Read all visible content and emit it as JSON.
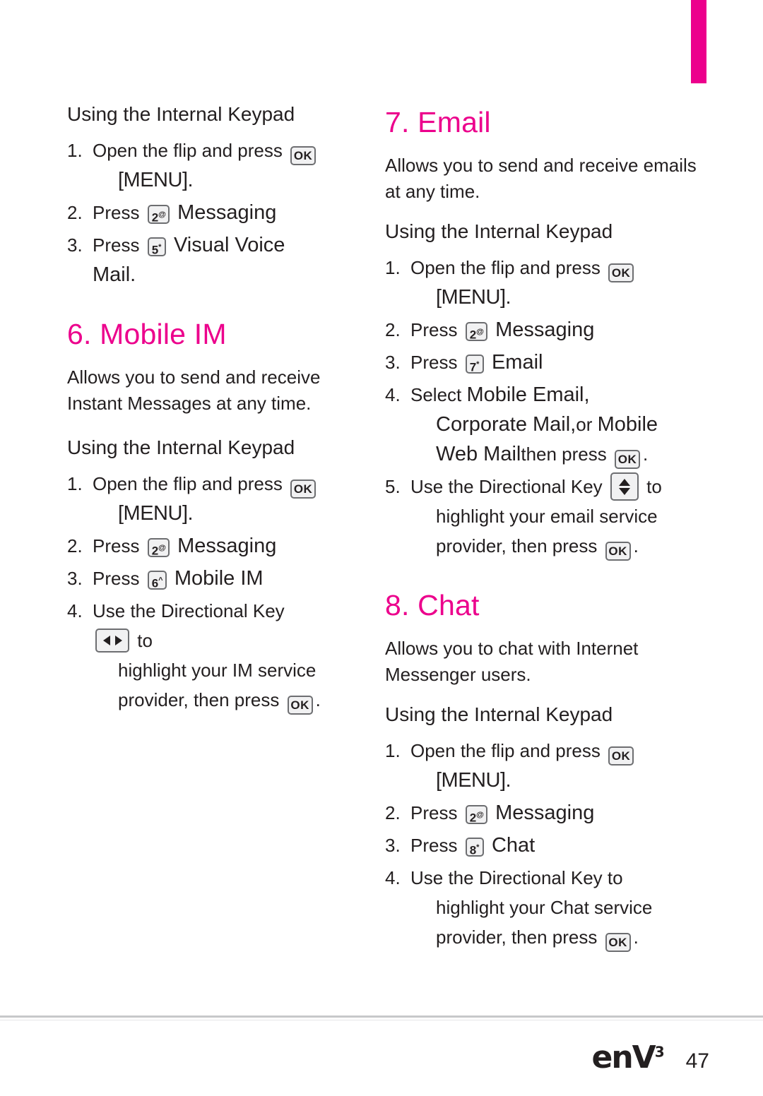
{
  "page": {
    "number": "47",
    "logo_text": "enV",
    "logo_sup": "3",
    "logo_dot": "·"
  },
  "left_column": {
    "keypad_heading_1": "Using the Internal Keypad",
    "vvm_steps": [
      {
        "num": "1.",
        "text_before": "Open the flip and press",
        "key": "OK",
        "text_after": "",
        "second_line": "[MENU]."
      },
      {
        "num": "2.",
        "text_before": "Press",
        "key": "2",
        "key_sup": "@",
        "text_after": "Messaging"
      },
      {
        "num": "3.",
        "text_before": "Press",
        "key": "5",
        "key_sup": "*",
        "text_after": "Visual Voice Mail."
      }
    ],
    "section_6": {
      "title": "6. Mobile IM",
      "intro": "Allows you to send and receive Instant Messages at any time.",
      "keypad_heading": "Using the Internal Keypad",
      "steps": [
        {
          "num": "1.",
          "text_before": "Open the flip and press",
          "key": "OK",
          "second_line": "[MENU]."
        },
        {
          "num": "2.",
          "text_before": "Press",
          "key": "2",
          "key_sup": "@",
          "text_after": "Messaging"
        },
        {
          "num": "3.",
          "text_before": "Press",
          "key": "6",
          "key_sup": "^",
          "text_after": "Mobile IM"
        },
        {
          "num": "4.",
          "text_before": "Use the Directional Key",
          "key": "left-right-arrows",
          "text_after": "to",
          "line2": "highlight your IM service",
          "line3_before": "provider, then press",
          "line3_key": "OK",
          "line3_after": "."
        }
      ]
    }
  },
  "right_column": {
    "section_7": {
      "title": "7. Email",
      "intro": "Allows you to send and receive emails at any time.",
      "keypad_heading": "Using the Internal Keypad",
      "steps": [
        {
          "num": "1.",
          "text_before": "Open the flip and press",
          "key": "OK",
          "second_line": "[MENU]."
        },
        {
          "num": "2.",
          "text_before": "Press",
          "key": "2",
          "key_sup": "@",
          "text_after": "Messaging"
        },
        {
          "num": "3.",
          "text_before": "Press",
          "key": "7",
          "key_sup": "*",
          "text_after": "Email"
        },
        {
          "num": "4.",
          "text_before": "Select",
          "ui_1": "Mobile Email,",
          "ui_2": "Corporate Mail,",
          "mid": "or",
          "ui_3": "Mobile",
          "ui_4": "Web Mail",
          "tail_before": "then press",
          "tail_key": "OK",
          "tail_after": "."
        },
        {
          "num": "5.",
          "text_before": "Use the Directional Key",
          "key": "up-down-arrows",
          "text_after": "to",
          "line2": "highlight your email service",
          "line3_before": "provider, then press",
          "line3_key": "OK",
          "line3_after": "."
        }
      ]
    },
    "section_8": {
      "title": "8. Chat",
      "intro": "Allows you to chat with Internet Messenger users.",
      "keypad_heading": "Using the Internal Keypad",
      "steps": [
        {
          "num": "1.",
          "text_before": "Open the flip and press",
          "key": "OK",
          "second_line": "[MENU]."
        },
        {
          "num": "2.",
          "text_before": "Press",
          "key": "2",
          "key_sup": "@",
          "text_after": "Messaging"
        },
        {
          "num": "3.",
          "text_before": "Press",
          "key": "8",
          "key_sup": "*",
          "text_after": "Chat"
        },
        {
          "num": "4.",
          "text_before": "Use the Directional Key to",
          "line2": "highlight your Chat service",
          "line3_before": "provider, then press",
          "line3_key": "OK",
          "line3_after": "."
        }
      ]
    }
  },
  "colors": {
    "accent": "#ec008c",
    "text": "#231f20",
    "keycap_border": "#6d6e71",
    "keycap_fill": "#f1f1f2",
    "rule": "#c7c8ca"
  }
}
